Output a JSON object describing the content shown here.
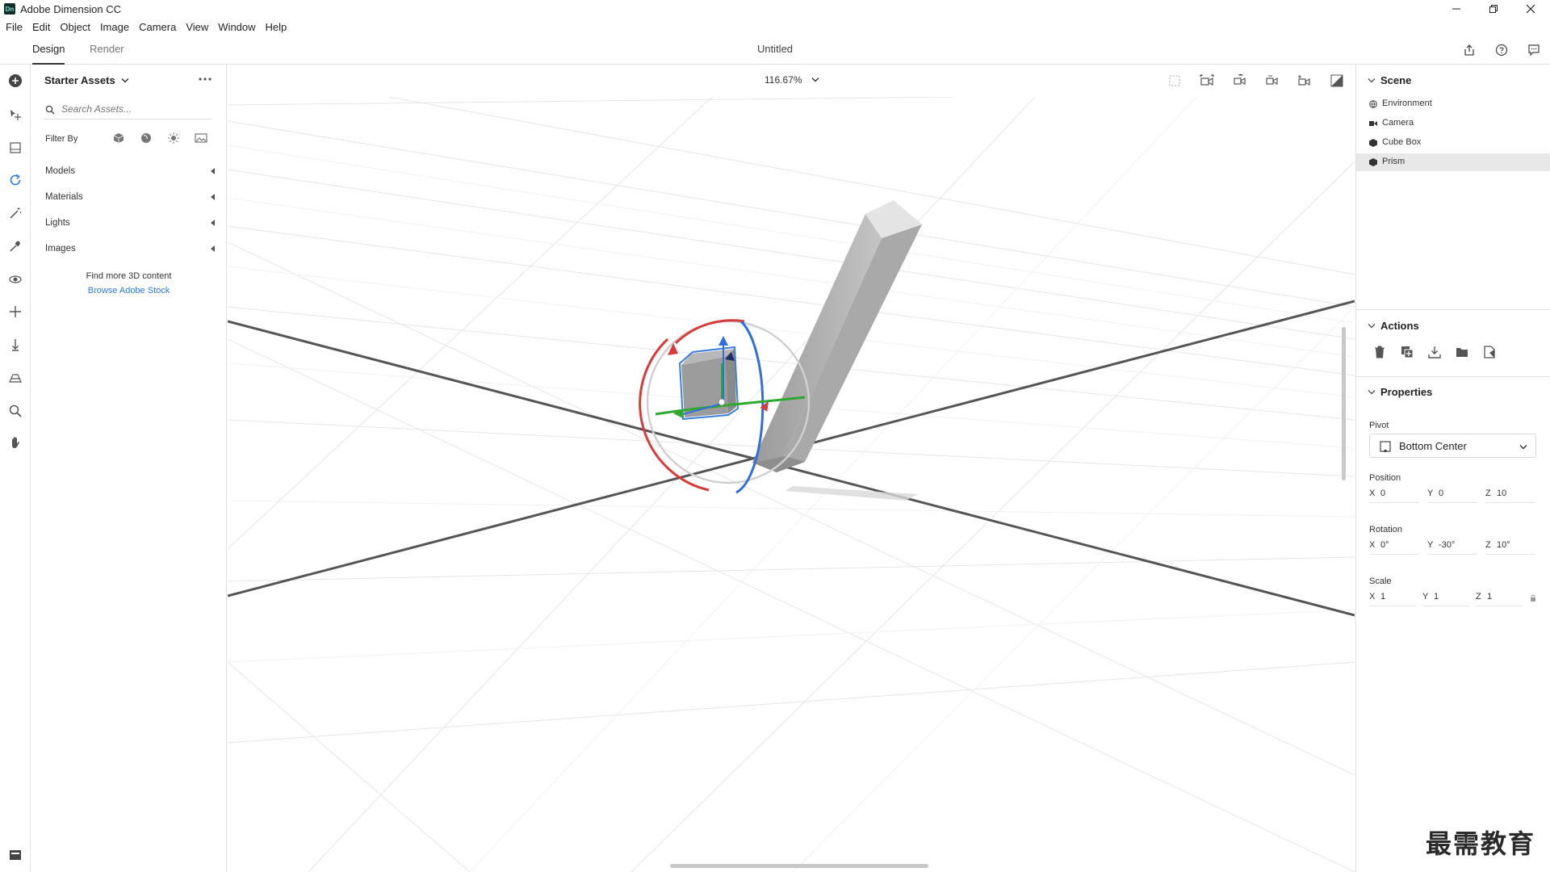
{
  "window": {
    "title": "Adobe Dimension CC",
    "logo_text": "Dn"
  },
  "menu": [
    "File",
    "Edit",
    "Object",
    "Image",
    "Camera",
    "View",
    "Window",
    "Help"
  ],
  "tabs": {
    "design": "Design",
    "render": "Render"
  },
  "document_title": "Untitled",
  "assets": {
    "title": "Starter Assets",
    "search_placeholder": "Search Assets...",
    "filter_label": "Filter By",
    "categories": [
      "Models",
      "Materials",
      "Lights",
      "Images"
    ],
    "find_more": "Find more 3D content",
    "browse_link": "Browse Adobe Stock"
  },
  "canvas": {
    "zoom": "116.67%"
  },
  "scene": {
    "title": "Scene",
    "items": [
      "Environment",
      "Camera",
      "Cube Box",
      "Prism"
    ],
    "selected": "Prism"
  },
  "actions": {
    "title": "Actions"
  },
  "properties": {
    "title": "Properties",
    "pivot_label": "Pivot",
    "pivot_value": "Bottom Center",
    "position_label": "Position",
    "position": {
      "x": "0",
      "y": "0",
      "z": "10"
    },
    "rotation_label": "Rotation",
    "rotation": {
      "x": "0°",
      "y": "-30°",
      "z": "10°"
    },
    "scale_label": "Scale",
    "scale": {
      "x": "1",
      "y": "1",
      "z": "1"
    }
  },
  "axis_labels": {
    "x": "X",
    "y": "Y",
    "z": "Z"
  },
  "watermark": "最需教育",
  "colors": {
    "accent": "#2d7be0",
    "gizmo_red": "#d83b3b",
    "gizmo_green": "#2ea82e",
    "gizmo_blue": "#2f6fdc",
    "selected_row": "#e8e8e8"
  }
}
